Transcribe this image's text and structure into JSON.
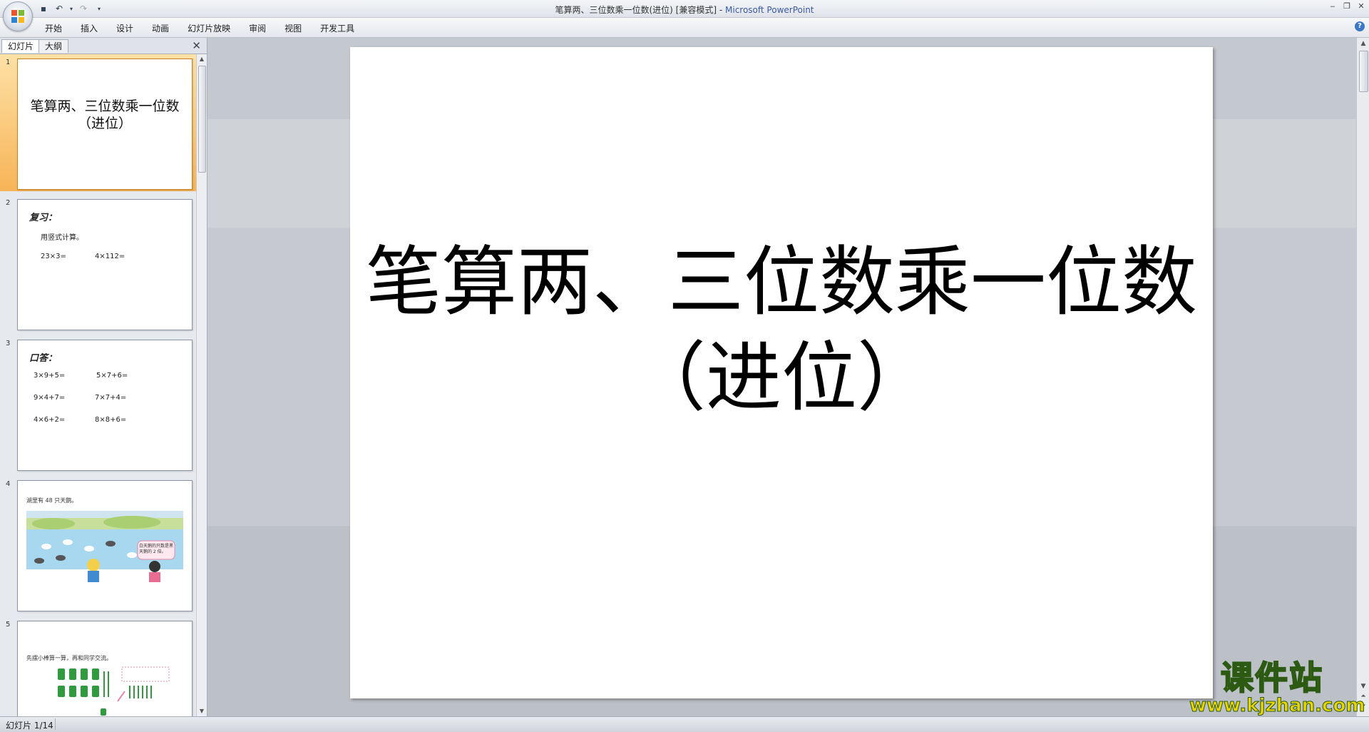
{
  "window": {
    "title_main": "笔算两、三位数乘一位数(进位) [兼容模式] - ",
    "title_app": "Microsoft PowerPoint",
    "controls": [
      "‒",
      "❐",
      "✕"
    ]
  },
  "ribbon": {
    "tabs": [
      "开始",
      "插入",
      "设计",
      "动画",
      "幻灯片放映",
      "审阅",
      "视图",
      "开发工具"
    ]
  },
  "left_pane": {
    "tab_slides": "幻灯片",
    "tab_outline": "大纲",
    "close": "✕",
    "thumbnails": [
      {
        "num": "1",
        "title_line1": "笔算两、三位数乘一位数",
        "title_line2": "（进位）"
      },
      {
        "num": "2",
        "heading": "复习：",
        "line1": "用竖式计算。",
        "expr1": "23×3=",
        "expr2": "4×112="
      },
      {
        "num": "3",
        "heading": "口答：",
        "rows": [
          [
            "3×9+5=",
            "5×7+6="
          ],
          [
            "9×4+7=",
            "7×7+4="
          ],
          [
            "4×6+2=",
            "8×8+6="
          ]
        ]
      },
      {
        "num": "4",
        "caption": "湖里有 48 只天鹅。",
        "bubble": "白天鹅的只数是黑天鹅的 2 倍。"
      },
      {
        "num": "5",
        "caption": "先摆小棒算一算，再和同学交流。"
      }
    ]
  },
  "slide": {
    "title_line1": "笔算两、三位数乘一位数",
    "title_line2": "（进位）"
  },
  "status": {
    "text": "幻灯片 1/14"
  },
  "watermark": {
    "top": "课件站",
    "bottom": "www.kjzhan.com"
  },
  "colors": {
    "selected_thumb": "#f7b457",
    "watermark_yellow": "#f3e60a",
    "watermark_green": "#2c5a12"
  }
}
